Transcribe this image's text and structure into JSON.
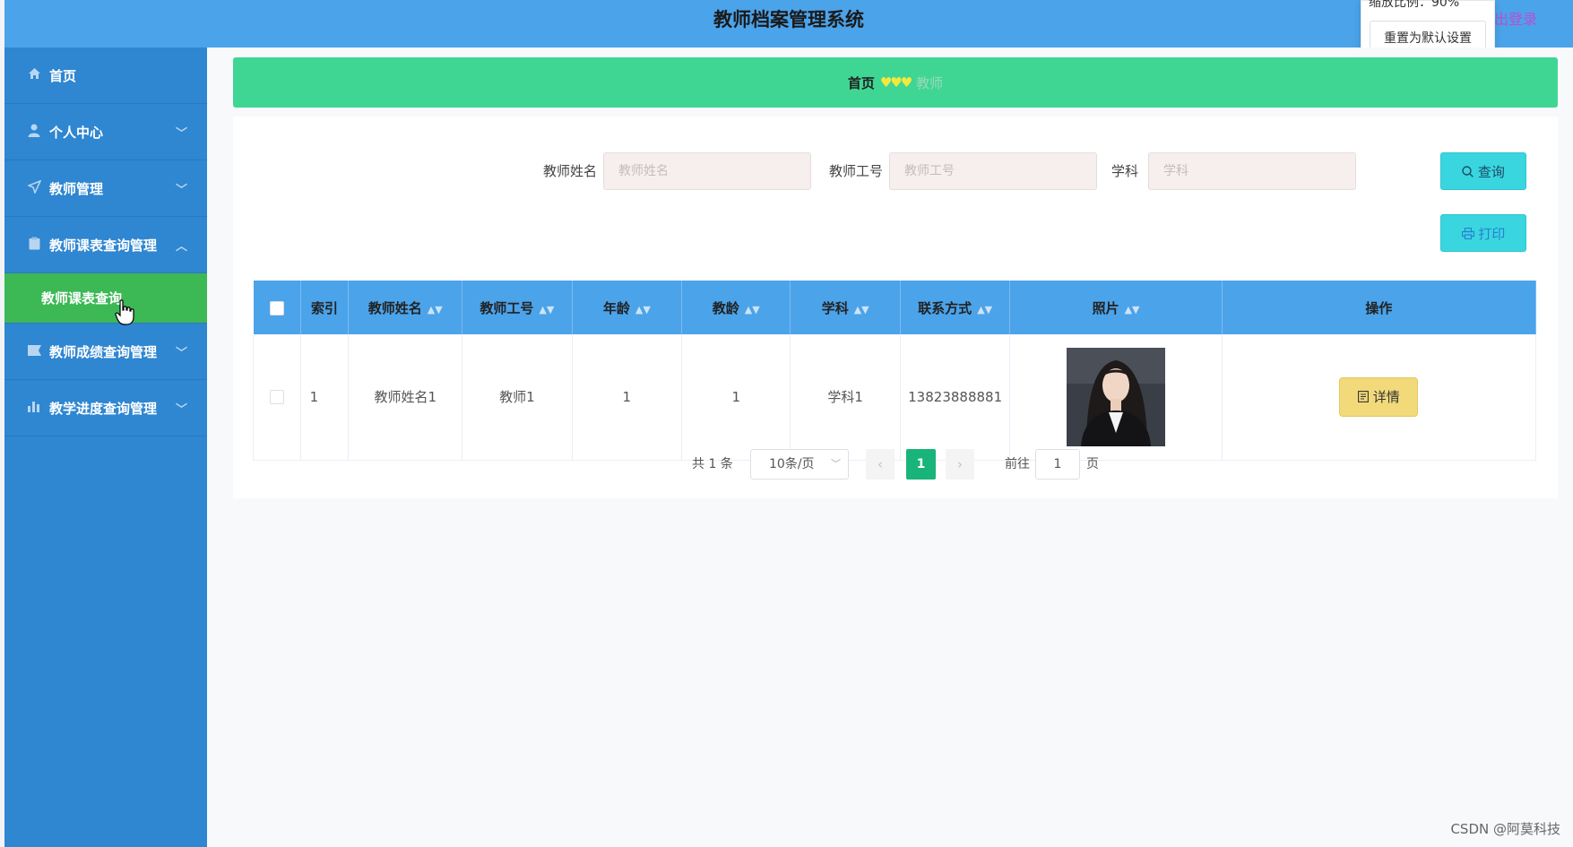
{
  "header": {
    "title": "教师档案管理系统",
    "logout": "出登录"
  },
  "zoom": {
    "label": "缩放比例：90%",
    "reset": "重置为默认设置"
  },
  "sidebar": {
    "items": [
      {
        "label": "首页",
        "icon": "home-icon"
      },
      {
        "label": "个人中心",
        "icon": "user-icon"
      },
      {
        "label": "教师管理",
        "icon": "send-icon"
      },
      {
        "label": "教师课表查询管理",
        "icon": "clipboard-icon"
      },
      {
        "label": "教师课表查询",
        "icon": ""
      },
      {
        "label": "教师成绩查询管理",
        "icon": "flag-icon"
      },
      {
        "label": "教学进度查询管理",
        "icon": "bar-chart-icon"
      }
    ]
  },
  "breadcrumb": {
    "home": "首页",
    "sep": "♥♥♥",
    "current": "教师"
  },
  "search": {
    "name_label": "教师姓名",
    "name_placeholder": "教师姓名",
    "id_label": "教师工号",
    "id_placeholder": "教师工号",
    "subject_label": "学科",
    "subject_placeholder": "学科",
    "query": "查询",
    "print": "打印"
  },
  "table": {
    "headers": [
      "索引",
      "教师姓名",
      "教师工号",
      "年龄",
      "教龄",
      "学科",
      "联系方式",
      "照片",
      "操作"
    ],
    "rows": [
      {
        "index": "1",
        "name": "教师姓名1",
        "id": "教师1",
        "age": "1",
        "years": "1",
        "subject": "学科1",
        "phone": "13823888881",
        "action": "详情"
      }
    ]
  },
  "pager": {
    "total": "共 1 条",
    "size": "10条/页",
    "current": "1",
    "goto": "前往",
    "goto_value": "1",
    "page": "页"
  },
  "watermark": "CSDN @阿莫科技",
  "colors": {
    "header": "#4ba3ea",
    "sidebar": "#2f86d1",
    "active": "#3cb855",
    "breadcrumb": "#3fd694",
    "accent": "#39d6e0"
  }
}
